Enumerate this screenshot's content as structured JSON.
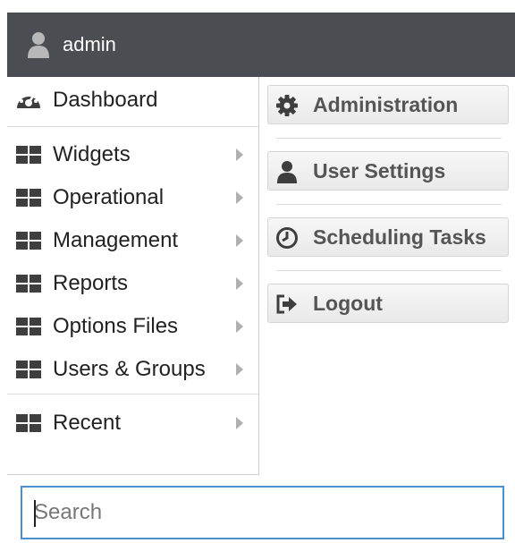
{
  "header": {
    "username": "admin",
    "user_icon": "user-icon",
    "background": "#4a4d52"
  },
  "menu": {
    "items": [
      {
        "label": "Dashboard",
        "icon": "dashboard-icon",
        "has_submenu": false
      },
      {
        "label": "Widgets",
        "icon": "grid-icon",
        "has_submenu": true
      },
      {
        "label": "Operational",
        "icon": "grid-icon",
        "has_submenu": true
      },
      {
        "label": "Management",
        "icon": "grid-icon",
        "has_submenu": true
      },
      {
        "label": "Reports",
        "icon": "grid-icon",
        "has_submenu": true
      },
      {
        "label": "Options Files",
        "icon": "grid-icon",
        "has_submenu": true
      },
      {
        "label": "Users & Groups",
        "icon": "grid-icon",
        "has_submenu": true
      },
      {
        "label": "Recent",
        "icon": "grid-icon",
        "has_submenu": true
      }
    ]
  },
  "actions": [
    {
      "label": "Administration",
      "icon": "gear-icon"
    },
    {
      "label": "User Settings",
      "icon": "user-icon"
    },
    {
      "label": "Scheduling Tasks",
      "icon": "clock-icon"
    },
    {
      "label": "Logout",
      "icon": "logout-icon"
    }
  ],
  "search": {
    "placeholder": "Search",
    "value": "",
    "border_color": "#4a90d0"
  }
}
